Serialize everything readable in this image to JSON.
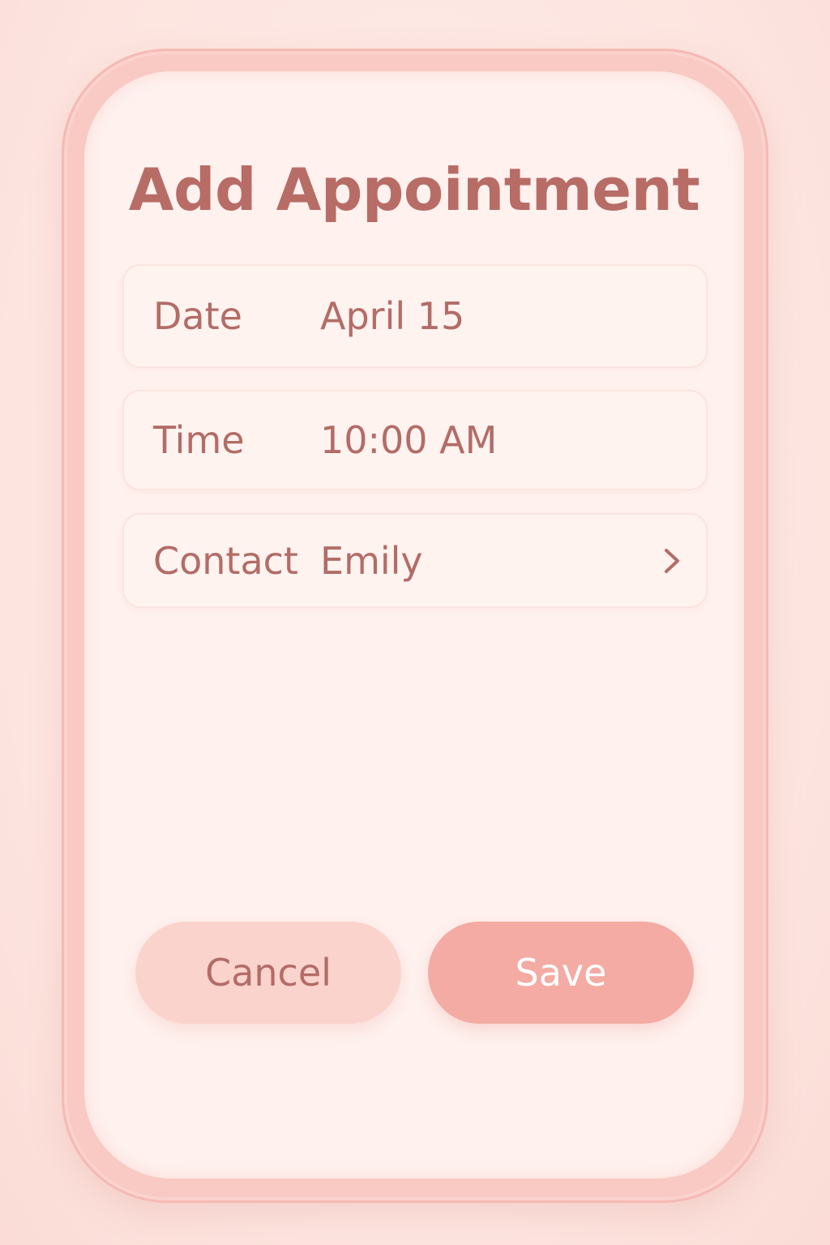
{
  "dialog": {
    "title": "Add Appointment"
  },
  "fields": {
    "date": {
      "label": "Date",
      "value": "April 15"
    },
    "time": {
      "label": "Time",
      "value": "10:00 AM"
    },
    "contact": {
      "label": "Contact",
      "value": "Emily",
      "icon": "chevron-right-icon"
    }
  },
  "actions": {
    "cancel_label": "Cancel",
    "save_label": "Save"
  },
  "colors": {
    "text": "#b36c66",
    "background": "#fde6e1",
    "screen": "#fff1ee",
    "frame": "#f9c9c4",
    "cancel_button": "#fbd3cd",
    "save_button": "#f4aba4"
  }
}
